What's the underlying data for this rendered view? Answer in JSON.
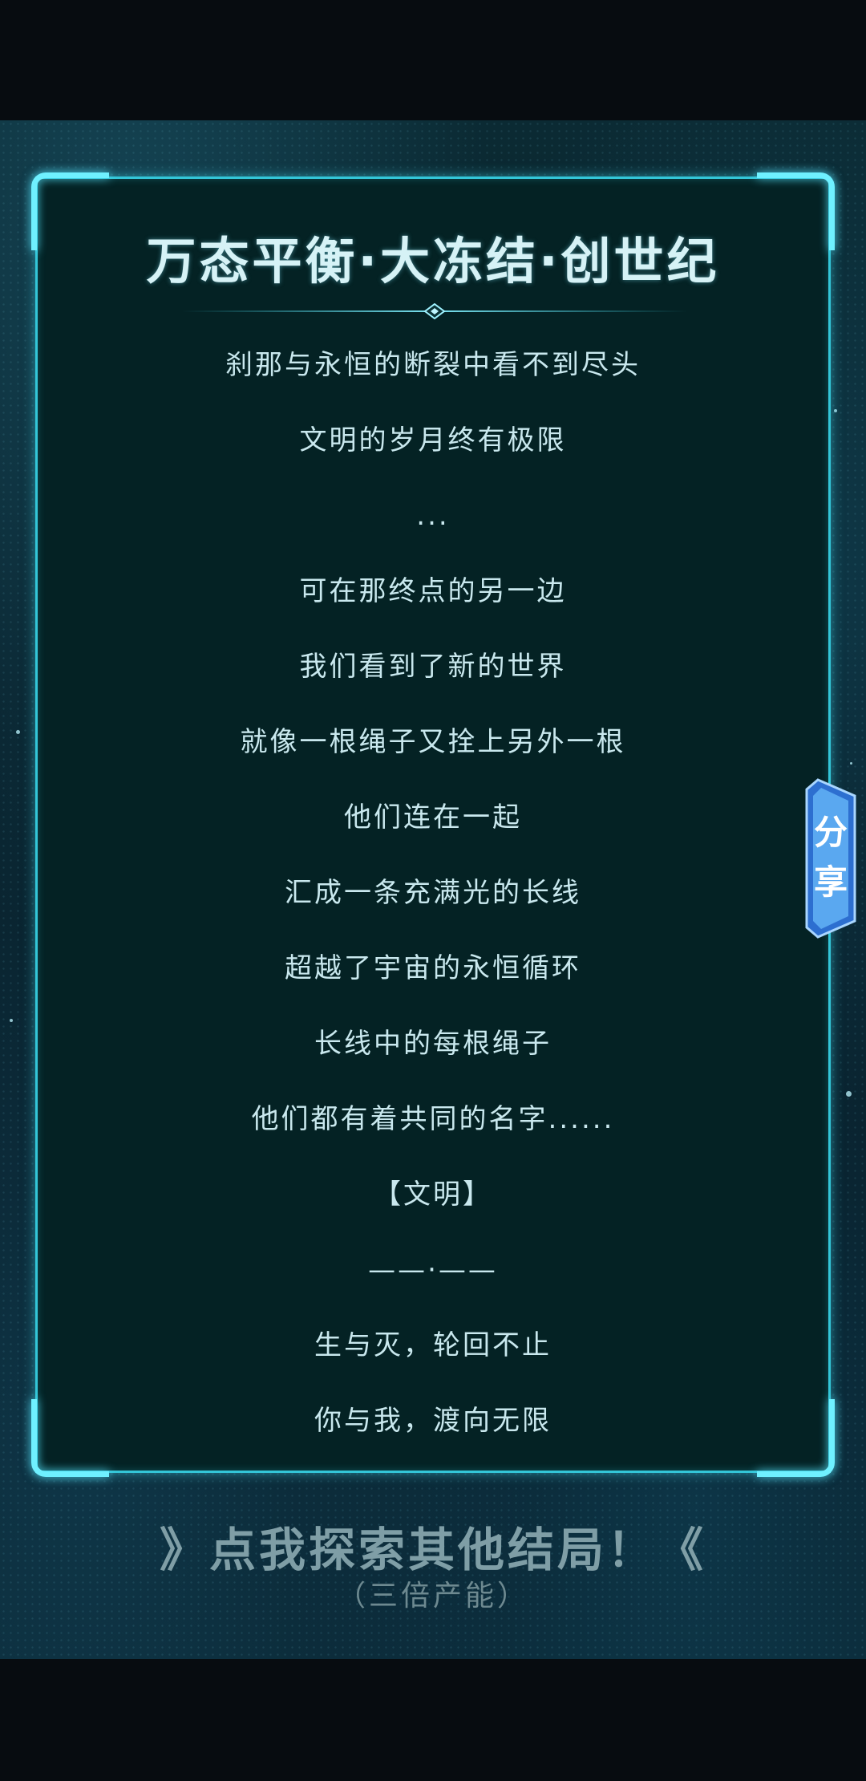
{
  "panel": {
    "title": "万态平衡·大冻结·创世纪",
    "lines": [
      "刹那与永恒的断裂中看不到尽头",
      "文明的岁月终有极限",
      "...",
      "可在那终点的另一边",
      "我们看到了新的世界",
      "就像一根绳子又拴上另外一根",
      "他们连在一起",
      "汇成一条充满光的长线",
      "超越了宇宙的永恒循环",
      "长线中的每根绳子",
      "他们都有着共同的名字......",
      "【文明】",
      "——·——",
      "生与灭，轮回不止",
      "你与我，渡向无限"
    ]
  },
  "share_tab": {
    "chars": [
      "分",
      "享"
    ],
    "icon": "share-tab"
  },
  "bottom": {
    "cta_label": "》点我探索其他结局！《",
    "cta_sub": "（三倍产能）"
  },
  "colors": {
    "panel_bg": "#042224",
    "frame": "#33c6d8",
    "frame_glow": "#6ff0ff",
    "text": "#c9e8ee",
    "share_tab": "#5aa8f0"
  }
}
